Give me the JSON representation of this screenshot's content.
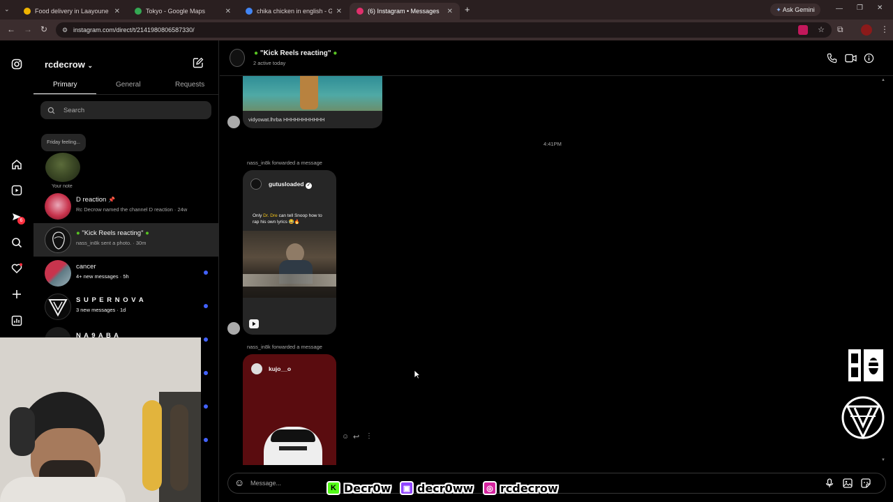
{
  "browser": {
    "tabs": [
      {
        "title": "Food delivery in Laayoune | Glo",
        "favicon_color": "#f0b400"
      },
      {
        "title": "Tokyo - Google Maps",
        "favicon_color": "#34a853"
      },
      {
        "title": "chika chicken in english - Goog",
        "favicon_color": "#4285f4"
      },
      {
        "title": "(6) Instagram • Messages",
        "favicon_color": "#e1306c"
      }
    ],
    "ask_gemini": "Ask Gemini",
    "url": "instagram.com/direct/t/2141980806587330/"
  },
  "rail": {
    "notification_count": "6"
  },
  "inbox": {
    "username": "rcdecrow",
    "tabs": [
      "Primary",
      "General",
      "Requests"
    ],
    "search_placeholder": "Search",
    "note_text": "Friday feeling...",
    "note_caption": "Your note",
    "conversations": [
      {
        "name": "D reaction",
        "subtitle": "Rc Decrow named the channel D reaction · 24w",
        "pinned": true,
        "unread": false
      },
      {
        "name": "\"Kick Reels reacting\"",
        "subtitle": "nass_in8k sent a photo. · 30m",
        "pinned": false,
        "unread": false
      },
      {
        "name": "cancer",
        "subtitle": "4+ new messages · 5h",
        "pinned": false,
        "unread": true
      },
      {
        "name": "S U P E R N O V A",
        "subtitle": "3 new messages · 1d",
        "pinned": false,
        "unread": true
      },
      {
        "name": "N A 9 A B A",
        "subtitle": "",
        "pinned": false,
        "unread": true
      }
    ]
  },
  "thread": {
    "title": "\"Kick Reels reacting\"",
    "status": "2 active today",
    "first_caption": "vidyowat.lhrba HHHHHHHHHHH",
    "timestamp": "4:41PM",
    "forward_label_1": "nass_in8k forwarded a message",
    "post1_author": "gutusloaded",
    "post1_caption_pre": "Only ",
    "post1_caption_highlight": "Dr. Dre",
    "post1_caption_post": " can tell Snoop how to rap his own lyrics 😂🔥",
    "forward_label_2": "nass_in8k forwarded a message",
    "post2_author": "kujo__o",
    "composer_placeholder": "Message..."
  },
  "overlay": {
    "kick": "Decr0w",
    "twitch": "decr0ww",
    "instagram": "rcdecrow"
  }
}
